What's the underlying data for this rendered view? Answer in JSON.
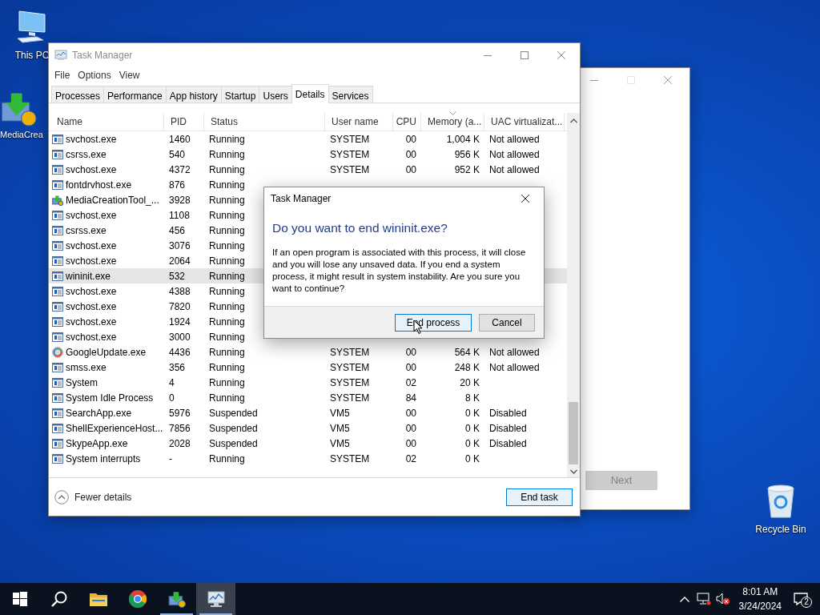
{
  "desktop_icons": [
    {
      "label": "This PC",
      "kind": "pc"
    },
    {
      "label": "MediaCrea",
      "kind": "installer"
    },
    {
      "label": "Recycle Bin",
      "kind": "bin"
    }
  ],
  "back_window": {
    "next_button": {
      "label": "Next",
      "disabled": true
    }
  },
  "task_manager": {
    "title": "Task Manager",
    "menu": [
      "File",
      "Options",
      "View"
    ],
    "tabs": [
      {
        "label": "Processes",
        "selected": false
      },
      {
        "label": "Performance",
        "selected": false
      },
      {
        "label": "App history",
        "selected": false
      },
      {
        "label": "Startup",
        "selected": false
      },
      {
        "label": "Users",
        "selected": false
      },
      {
        "label": "Details",
        "selected": true
      },
      {
        "label": "Services",
        "selected": false
      }
    ],
    "columns": [
      {
        "label": "Name",
        "sorted": false
      },
      {
        "label": "PID",
        "sorted": false
      },
      {
        "label": "Status",
        "sorted": false
      },
      {
        "label": "User name",
        "sorted": false
      },
      {
        "label": "CPU",
        "sorted": false
      },
      {
        "label": "Memory (a...",
        "sorted": true
      },
      {
        "label": "UAC virtualizat...",
        "sorted": false
      }
    ],
    "rows": [
      {
        "kind": "app",
        "name": "svchost.exe",
        "pid": "1460",
        "status": "Running",
        "user_name": "SYSTEM",
        "cpu": "00",
        "memory": "1,004 K",
        "uac": "Not allowed",
        "selected": false
      },
      {
        "kind": "app",
        "name": "csrss.exe",
        "pid": "540",
        "status": "Running",
        "user_name": "SYSTEM",
        "cpu": "00",
        "memory": "956 K",
        "uac": "Not allowed",
        "selected": false
      },
      {
        "kind": "app",
        "name": "svchost.exe",
        "pid": "4372",
        "status": "Running",
        "user_name": "SYSTEM",
        "cpu": "00",
        "memory": "952 K",
        "uac": "Not allowed",
        "selected": false
      },
      {
        "kind": "app",
        "name": "fontdrvhost.exe",
        "pid": "876",
        "status": "Running",
        "selected": false
      },
      {
        "kind": "installer",
        "name": "MediaCreationTool_...",
        "pid": "3928",
        "status": "Running",
        "selected": false
      },
      {
        "kind": "app",
        "name": "svchost.exe",
        "pid": "1108",
        "status": "Running",
        "selected": false
      },
      {
        "kind": "app",
        "name": "csrss.exe",
        "pid": "456",
        "status": "Running",
        "selected": false
      },
      {
        "kind": "app",
        "name": "svchost.exe",
        "pid": "3076",
        "status": "Running",
        "selected": false
      },
      {
        "kind": "app",
        "name": "svchost.exe",
        "pid": "2064",
        "status": "Running",
        "selected": false
      },
      {
        "kind": "app",
        "name": "wininit.exe",
        "pid": "532",
        "status": "Running",
        "selected": true
      },
      {
        "kind": "app",
        "name": "svchost.exe",
        "pid": "4388",
        "status": "Running",
        "selected": false
      },
      {
        "kind": "app",
        "name": "svchost.exe",
        "pid": "7820",
        "status": "Running",
        "selected": false
      },
      {
        "kind": "app",
        "name": "svchost.exe",
        "pid": "1924",
        "status": "Running",
        "selected": false
      },
      {
        "kind": "app",
        "name": "svchost.exe",
        "pid": "3000",
        "status": "Running",
        "selected": false
      },
      {
        "kind": "update",
        "name": "GoogleUpdate.exe",
        "pid": "4436",
        "status": "Running",
        "user_name": "SYSTEM",
        "cpu": "00",
        "memory": "564 K",
        "uac": "Not allowed",
        "selected": false
      },
      {
        "kind": "app",
        "name": "smss.exe",
        "pid": "356",
        "status": "Running",
        "user_name": "SYSTEM",
        "cpu": "00",
        "memory": "248 K",
        "uac": "Not allowed",
        "selected": false
      },
      {
        "kind": "app",
        "name": "System",
        "pid": "4",
        "status": "Running",
        "user_name": "SYSTEM",
        "cpu": "02",
        "memory": "20 K",
        "selected": false
      },
      {
        "kind": "app",
        "name": "System Idle Process",
        "pid": "0",
        "status": "Running",
        "user_name": "SYSTEM",
        "cpu": "84",
        "memory": "8 K",
        "selected": false
      },
      {
        "kind": "app",
        "name": "SearchApp.exe",
        "pid": "5976",
        "status": "Suspended",
        "user_name": "VM5",
        "cpu": "00",
        "memory": "0 K",
        "uac": "Disabled",
        "selected": false
      },
      {
        "kind": "app",
        "name": "ShellExperienceHost...",
        "pid": "7856",
        "status": "Suspended",
        "user_name": "VM5",
        "cpu": "00",
        "memory": "0 K",
        "uac": "Disabled",
        "selected": false
      },
      {
        "kind": "app",
        "name": "SkypeApp.exe",
        "pid": "2028",
        "status": "Suspended",
        "user_name": "VM5",
        "cpu": "00",
        "memory": "0 K",
        "uac": "Disabled",
        "selected": false
      },
      {
        "kind": "app",
        "name": "System interrupts",
        "pid": "-",
        "status": "Running",
        "user_name": "SYSTEM",
        "cpu": "02",
        "memory": "0 K",
        "selected": false
      }
    ],
    "fewer_details": "Fewer details",
    "end_task": "End task"
  },
  "dialog": {
    "title": "Task Manager",
    "heading": "Do you want to end wininit.exe?",
    "message": "If an open program is associated with this process, it will close and you will lose any unsaved data. If you end a system process, it might result in system instability. Are you sure you want to continue?",
    "buttons": [
      {
        "label": "End process",
        "default": true
      },
      {
        "label": "Cancel",
        "default": false
      }
    ]
  },
  "taskbar": {
    "apps": [
      {
        "kind": "start",
        "running": false,
        "active": false
      },
      {
        "kind": "search",
        "running": false,
        "active": false
      },
      {
        "kind": "folder",
        "running": false,
        "active": false
      },
      {
        "kind": "browser",
        "running": false,
        "active": false
      },
      {
        "kind": "installer",
        "running": true,
        "active": false
      },
      {
        "kind": "taskmgr",
        "running": true,
        "active": true
      }
    ],
    "time": "8:01 AM",
    "date": "3/24/2024",
    "notifications": "2"
  }
}
